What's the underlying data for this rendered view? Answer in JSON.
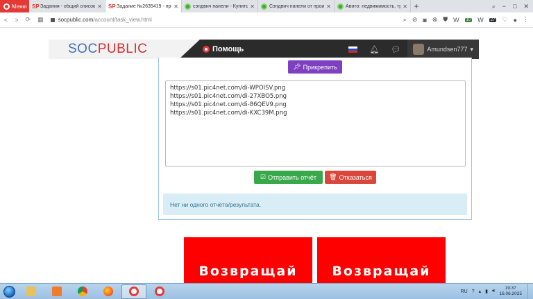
{
  "browser": {
    "menu_label": "Меню",
    "tabs": [
      {
        "title": "Задания - общий список з",
        "favicon": "SP",
        "active": false
      },
      {
        "title": "Задание №2635419 - про",
        "favicon": "SP",
        "active": true
      },
      {
        "title": "сэндвич панели - Купить",
        "favicon": "green",
        "active": false
      },
      {
        "title": "Сэндвич панели от произ",
        "favicon": "green",
        "active": false
      },
      {
        "title": "Авито: недвижимость, тра",
        "favicon": "green",
        "active": false
      }
    ],
    "new_tab": "+",
    "window_controls": {
      "search": "⌕",
      "minimize": "−",
      "maximize": "□",
      "close": "✕"
    },
    "address": {
      "domain": "socpublic.com",
      "path": "/account/task_view.html"
    },
    "extension_badges": {
      "a": "10",
      "b": "27"
    }
  },
  "site": {
    "logo_soc": "SOC",
    "logo_public": "PUBLIC",
    "help_label": "Помощь",
    "username": "Amundsen777"
  },
  "task": {
    "pin_label": "Прикрепить",
    "links": [
      "https://s01.pic4net.com/di-WPOISV.png",
      "https://s01.pic4net.com/di-27XBO5.png",
      "https://s01.pic4net.com/di-86QEV9.png",
      "https://s01.pic4net.com/di-KXC39M.png"
    ],
    "submit_label": "Отправить отчёт",
    "refuse_label": "Отказаться",
    "notice": "Нет ни одного отчёта/результата."
  },
  "banners": {
    "left": "Возвращай",
    "right": "Возвращай"
  },
  "taskbar": {
    "lang": "RU",
    "time": "19:37",
    "date": "16.06.2025"
  }
}
